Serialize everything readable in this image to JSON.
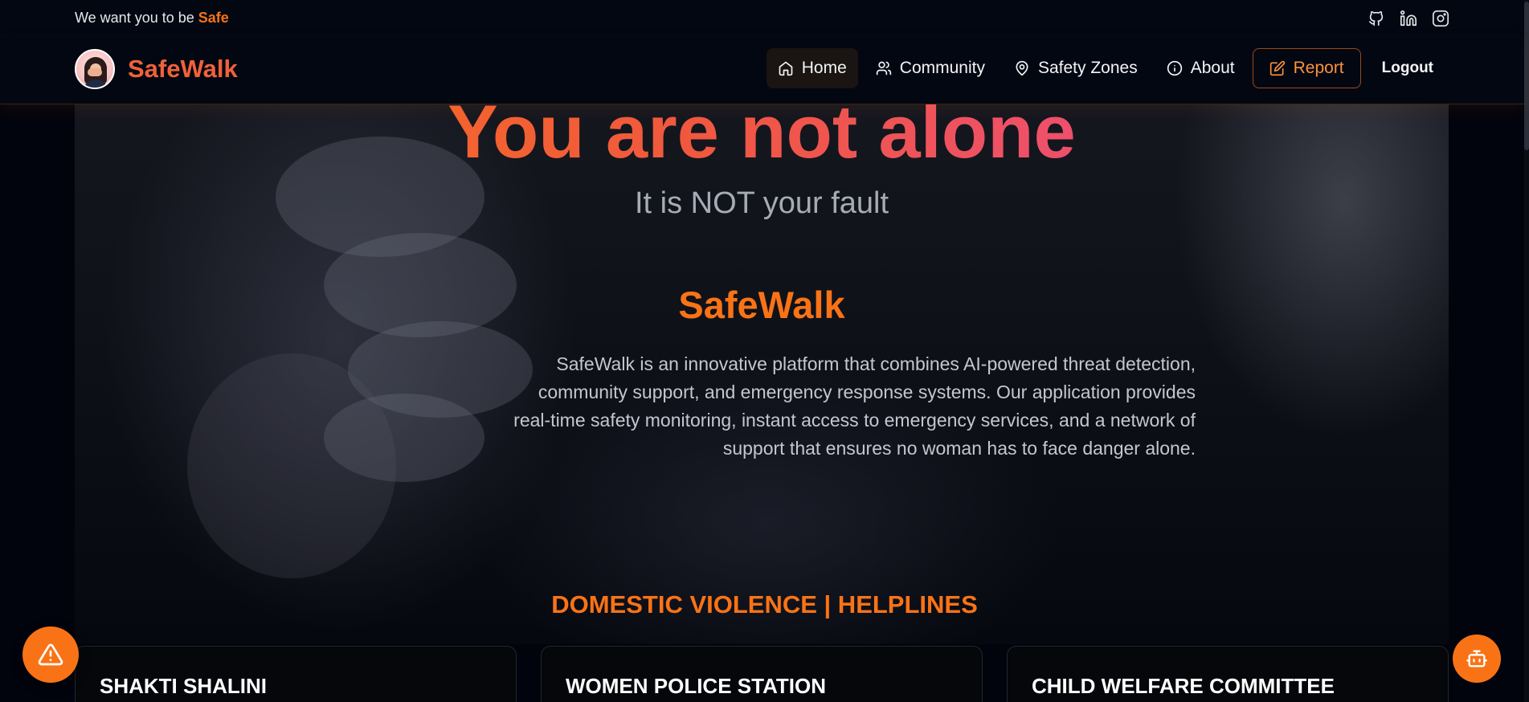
{
  "topbar": {
    "tagline_prefix": "We want you to be ",
    "tagline_accent": "Safe",
    "social": [
      "github-icon",
      "linkedin-icon",
      "instagram-icon"
    ]
  },
  "brand": {
    "name": "SafeWalk"
  },
  "nav": {
    "home": "Home",
    "community": "Community",
    "safety_zones": "Safety Zones",
    "about": "About",
    "report": "Report",
    "logout": "Logout"
  },
  "hero": {
    "title": "You are not alone",
    "subtitle": "It is NOT your fault",
    "section_title": "SafeWalk",
    "description": "SafeWalk is an innovative platform that combines AI-powered threat detection, community support, and emergency response systems. Our application provides real-time safety monitoring, instant access to emergency services, and a network of support that ensures no woman has to face danger alone."
  },
  "helplines": {
    "title": "DOMESTIC VIOLENCE | HELPLINES",
    "cards": [
      "SHAKTI SHALINI",
      "WOMEN POLICE STATION",
      "CHILD WELFARE COMMITTEE"
    ]
  },
  "colors": {
    "accent": "#f97316",
    "brand": "#f0613a",
    "gradient_end": "#ec4899",
    "background": "#02040d"
  }
}
